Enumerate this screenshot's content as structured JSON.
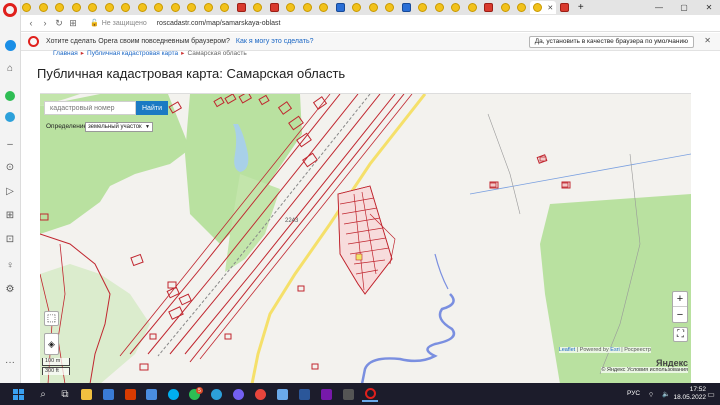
{
  "browser": {
    "address_status": "Не защищено",
    "url": "roscadastr.com/map/samarskaya-oblast",
    "tab_count_icons": 34
  },
  "promo": {
    "text": "Хотите сделать Opera своим повседневным браузером?",
    "link": "Как я могу это сделать?",
    "button": "Да, установить в качестве браузера по умолчанию"
  },
  "page": {
    "breadcrumb": [
      "Главная",
      "Публичная кадастровая карта",
      "Самарская область"
    ],
    "title": "Публичная кадастровая карта: Самарская область"
  },
  "map": {
    "search_placeholder": "кадастровый номер",
    "search_button": "Найти",
    "definition_label": "Определение:",
    "definition_value": "земельный участок",
    "road_label": "2243",
    "scale_m": "100 m",
    "scale_ft": "300 ft",
    "attribution_leaflet": "Leaflet",
    "attribution_powered": "| Powered by",
    "attribution_esri": "Esri",
    "attribution_rosreestr": "| Росреестр",
    "yandex_logo": "Яндекс",
    "yandex_terms_prefix": "© Яндекс",
    "yandex_terms_link": "Условия использования",
    "zoom_in": "+",
    "zoom_out": "−"
  },
  "taskbar": {
    "time": "17:52",
    "date": "18.05.2022",
    "lang": "РУС",
    "badge_count": "5"
  },
  "colors": {
    "parcel": "#c0262f",
    "forest": "#b9e1a0",
    "field": "#f3f2ee",
    "road": "#f5e06a",
    "water": "#7a8fe0"
  }
}
